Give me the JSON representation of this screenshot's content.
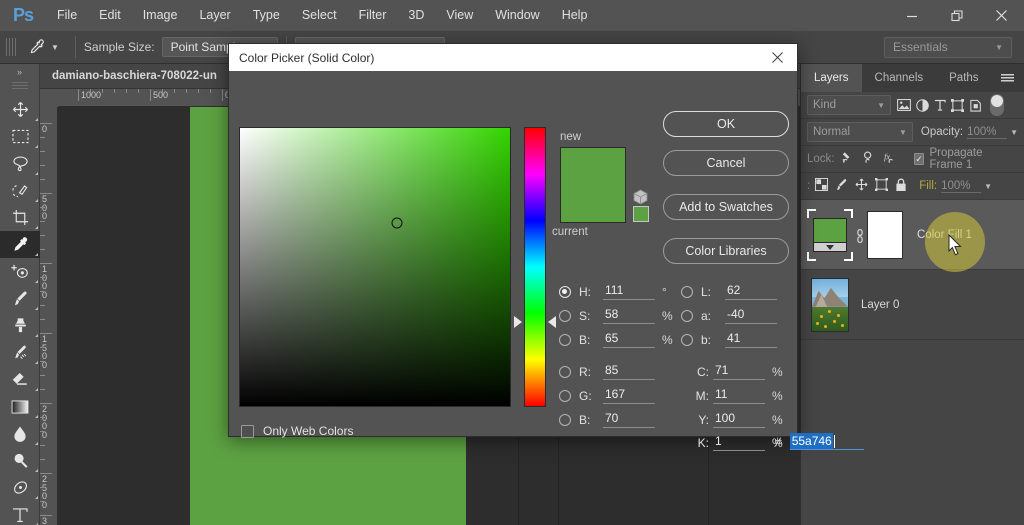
{
  "app": {
    "logo": "Ps",
    "menus": [
      "File",
      "Edit",
      "Image",
      "Layer",
      "Type",
      "Select",
      "Filter",
      "3D",
      "View",
      "Window",
      "Help"
    ],
    "window_controls": [
      "minimize",
      "restore",
      "close"
    ],
    "workspace": "Essentials"
  },
  "options_bar": {
    "tool": "eyedropper-tool",
    "sample_size_label": "Sample Size:",
    "sample_size_value": "Point Sample"
  },
  "toolbar": {
    "tools": [
      {
        "name": "move-tool",
        "active": false
      },
      {
        "name": "rectangular-marquee-tool",
        "active": false
      },
      {
        "name": "lasso-tool",
        "active": false
      },
      {
        "name": "quick-selection-tool",
        "active": false
      },
      {
        "name": "crop-tool",
        "active": false
      },
      {
        "name": "eyedropper-tool",
        "active": true
      },
      {
        "name": "spot-healing-brush-tool",
        "active": false
      },
      {
        "name": "brush-tool",
        "active": false
      },
      {
        "name": "clone-stamp-tool",
        "active": false
      },
      {
        "name": "history-brush-tool",
        "active": false
      },
      {
        "name": "eraser-tool",
        "active": false
      },
      {
        "name": "gradient-tool",
        "active": false
      },
      {
        "name": "blur-tool",
        "active": false
      },
      {
        "name": "dodge-tool",
        "active": false
      },
      {
        "name": "pen-tool",
        "active": false
      },
      {
        "name": "type-tool",
        "active": false
      }
    ]
  },
  "document": {
    "tab_title": "damiano-baschiera-708022-un",
    "ruler_h_labels": [
      "1000",
      "500",
      "0"
    ],
    "ruler_v_labels": [
      "0",
      "500",
      "1000",
      "1500",
      "2000",
      "2500",
      "3"
    ],
    "canvas_fill_color": "#5da242"
  },
  "layers_panel": {
    "tabs": [
      {
        "label": "Layers",
        "active": true
      },
      {
        "label": "Channels",
        "active": false
      },
      {
        "label": "Paths",
        "active": false
      }
    ],
    "kind_filter": "Kind",
    "filter_icons": [
      "pixel-layer-filter-icon",
      "adjustment-layer-filter-icon",
      "type-layer-filter-icon",
      "shape-layer-filter-icon",
      "smart-object-filter-icon"
    ],
    "blend_mode": "Normal",
    "opacity_label": "Opacity:",
    "opacity_value": "100%",
    "lock_label": "Lock:",
    "lock_icons": [
      "lock-transparent-pixels-icon",
      "lock-image-pixels-icon",
      "lock-effects-icon"
    ],
    "propagate_label": "Propagate Frame 1",
    "propagate_checked": true,
    "lock_row2_icons": [
      "transparency-icon",
      "brush-icon",
      "move-icon",
      "artboard-icon",
      "lock-all-icon"
    ],
    "fill_label": "Fill:",
    "fill_value": "100%",
    "layers": [
      {
        "name": "Color Fill 1",
        "selected": true,
        "thumb": "solid-color-fill-thumb",
        "has_mask": true
      },
      {
        "name": "Layer 0",
        "selected": false,
        "thumb": "photo-thumb",
        "has_mask": false
      }
    ]
  },
  "color_picker": {
    "title": "Color Picker (Solid Color)",
    "close_label": "close",
    "new_label": "new",
    "current_label": "current",
    "new_color": "#5da242",
    "current_color": "#5da242",
    "buttons": [
      {
        "label": "OK",
        "name": "ok-button"
      },
      {
        "label": "Cancel",
        "name": "cancel-button"
      },
      {
        "label": "Add to Swatches",
        "name": "add-to-swatches-button"
      },
      {
        "label": "Color Libraries",
        "name": "color-libraries-button"
      }
    ],
    "hsb": [
      {
        "key": "H:",
        "value": "111",
        "unit": "°",
        "selected": true
      },
      {
        "key": "S:",
        "value": "58",
        "unit": "%",
        "selected": false
      },
      {
        "key": "B:",
        "value": "65",
        "unit": "%",
        "selected": false
      }
    ],
    "rgb": [
      {
        "key": "R:",
        "value": "85",
        "unit": "",
        "selected": false
      },
      {
        "key": "G:",
        "value": "167",
        "unit": "",
        "selected": false
      },
      {
        "key": "B:",
        "value": "70",
        "unit": "",
        "selected": false
      }
    ],
    "lab": [
      {
        "key": "L:",
        "value": "62",
        "unit": "",
        "selected": false
      },
      {
        "key": "a:",
        "value": "-40",
        "unit": "",
        "selected": false
      },
      {
        "key": "b:",
        "value": "41",
        "unit": "",
        "selected": false
      }
    ],
    "cmyk": [
      {
        "key": "C:",
        "value": "71",
        "unit": "%"
      },
      {
        "key": "M:",
        "value": "11",
        "unit": "%"
      },
      {
        "key": "Y:",
        "value": "100",
        "unit": "%"
      },
      {
        "key": "K:",
        "value": "1",
        "unit": "%"
      }
    ],
    "hex_symbol": "#",
    "hex_value": "55a746",
    "only_web_colors_label": "Only Web Colors",
    "only_web_colors_checked": false
  }
}
